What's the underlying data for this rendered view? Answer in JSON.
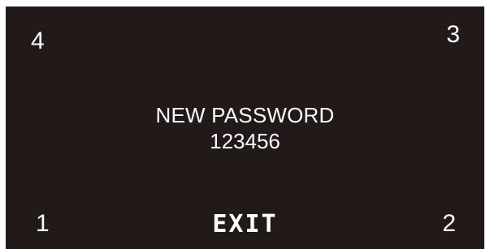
{
  "corners": {
    "top_left": "4",
    "top_right": "3",
    "bottom_left": "1",
    "bottom_right": "2"
  },
  "center": {
    "title": "NEW PASSWORD",
    "value": "123456"
  },
  "footer": {
    "exit_label": "EXIT"
  },
  "colors": {
    "background": "#221a18",
    "text": "#ffffff"
  }
}
